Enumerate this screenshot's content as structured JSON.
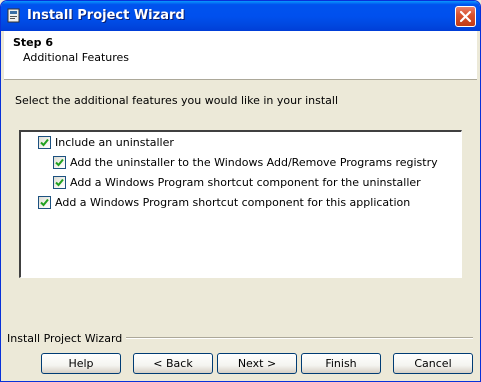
{
  "window": {
    "title": "Install Project Wizard"
  },
  "header": {
    "step": "Step 6",
    "subtitle": "Additional Features"
  },
  "instruction": "Select the additional features you would like in your install",
  "options": [
    {
      "label": "Include an uninstaller",
      "checked": true
    },
    {
      "label": "Add the uninstaller to the Windows Add/Remove Programs registry",
      "checked": true
    },
    {
      "label": "Add a Windows Program shortcut component for the uninstaller",
      "checked": true
    },
    {
      "label": "Add a Windows Program shortcut component for this application",
      "checked": true
    }
  ],
  "footer": {
    "group_label": "Install Project Wizard"
  },
  "buttons": {
    "help": "Help",
    "back": "< Back",
    "next": "Next >",
    "finish": "Finish",
    "cancel": "Cancel"
  },
  "colors": {
    "title_bar": "#0053ee",
    "check_mark": "#21a121",
    "close_button": "#d9532f"
  }
}
